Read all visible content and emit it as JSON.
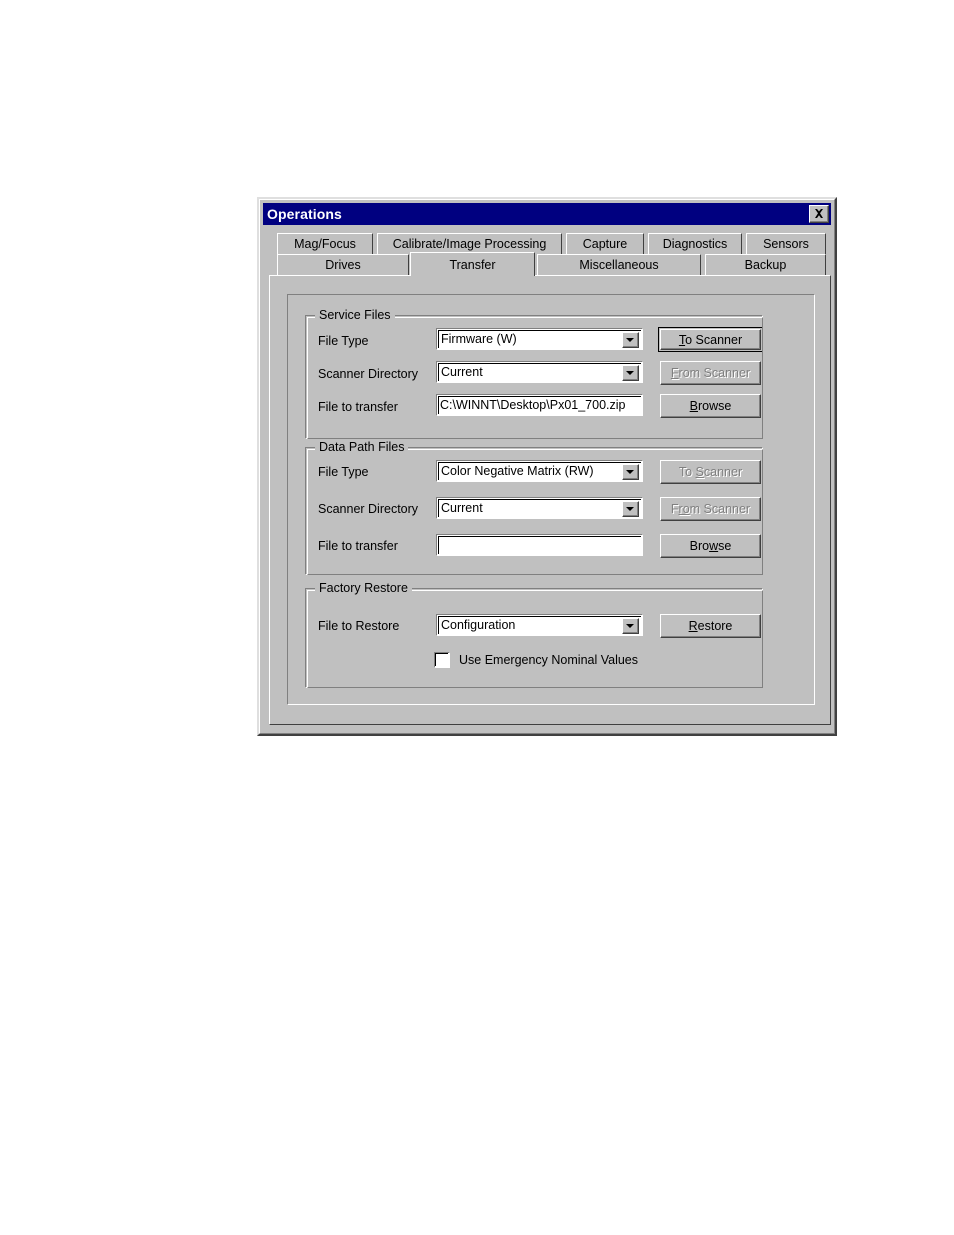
{
  "window": {
    "title": "Operations",
    "close_icon": "close-icon",
    "titlebar_color": "#000080",
    "face_color": "#c0c0c0"
  },
  "tabs": {
    "row1": [
      {
        "label": "Mag/Focus",
        "selected": false
      },
      {
        "label": "Calibrate/Image Processing",
        "selected": false
      },
      {
        "label": "Capture",
        "selected": false
      },
      {
        "label": "Diagnostics",
        "selected": false
      },
      {
        "label": "Sensors",
        "selected": false
      }
    ],
    "row2": [
      {
        "label": "Drives",
        "selected": false
      },
      {
        "label": "Transfer",
        "selected": true
      },
      {
        "label": "Miscellaneous",
        "selected": false
      },
      {
        "label": "Backup",
        "selected": false
      }
    ],
    "active": "Transfer"
  },
  "service_files": {
    "group_title": "Service Files",
    "file_type_label": "File Type",
    "file_type_value": "Firmware (W)",
    "scanner_dir_label": "Scanner Directory",
    "scanner_dir_value": "Current",
    "file_transfer_label": "File to transfer",
    "file_transfer_value": "C:\\WINNT\\Desktop\\Px01_700.zip",
    "file_transfer_placeholder": "",
    "to_scanner_prefix": "T",
    "to_scanner_rest": "o Scanner",
    "from_scanner_prefix": "F",
    "from_scanner_rest": "rom Scanner",
    "browse_prefix": "B",
    "browse_rest": "rowse",
    "to_scanner_enabled": true,
    "from_scanner_enabled": false,
    "browse_enabled": true
  },
  "data_path_files": {
    "group_title": "Data Path Files",
    "file_type_label": "File Type",
    "file_type_value": "Color Negative Matrix (RW)",
    "scanner_dir_label": "Scanner Directory",
    "scanner_dir_value": "Current",
    "file_transfer_label": "File to transfer",
    "file_transfer_value": "",
    "file_transfer_placeholder": "",
    "to_scanner_pre": "To ",
    "to_scanner_mid": "S",
    "to_scanner_post": "canner",
    "from_scanner_pre": "F",
    "from_scanner_mid": "ro",
    "from_scanner_post": "m Scanner",
    "browse_pre": "Bro",
    "browse_mid": "w",
    "browse_post": "se",
    "to_scanner_enabled": false,
    "from_scanner_enabled": false,
    "browse_enabled": true
  },
  "factory_restore": {
    "group_title": "Factory Restore",
    "file_restore_label": "File to Restore",
    "file_restore_value": "Configuration",
    "restore_prefix": "R",
    "restore_rest": "estore",
    "checkbox_label": "Use Emergency Nominal Values",
    "checkbox_checked": false
  }
}
